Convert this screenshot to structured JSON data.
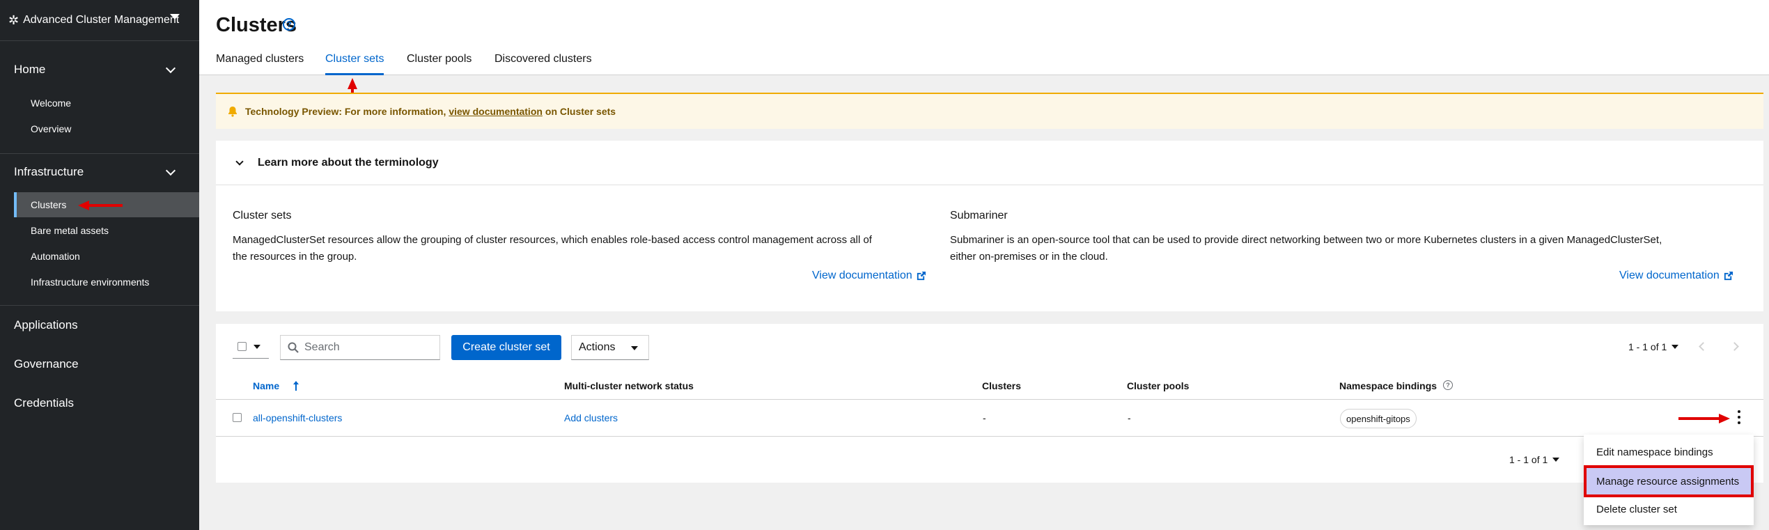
{
  "sidebar": {
    "brand": "Advanced Cluster Management",
    "groups": [
      {
        "label": "Home",
        "items": [
          "Welcome",
          "Overview"
        ]
      },
      {
        "label": "Infrastructure",
        "items": [
          "Clusters",
          "Bare metal assets",
          "Automation",
          "Infrastructure environments"
        ]
      },
      {
        "label": "Applications"
      },
      {
        "label": "Governance"
      },
      {
        "label": "Credentials"
      }
    ],
    "active_item": "Clusters"
  },
  "header": {
    "title": "Clusters",
    "tabs": [
      "Managed clusters",
      "Cluster sets",
      "Cluster pools",
      "Discovered clusters"
    ],
    "active_tab": "Cluster sets"
  },
  "alert": {
    "prefix": "Technology Preview: For more information,",
    "link": "view documentation",
    "suffix": "on Cluster sets"
  },
  "terminology": {
    "heading": "Learn more about the terminology",
    "cluster_sets": {
      "title": "Cluster sets",
      "line1": "ManagedClusterSet resources allow the grouping of cluster resources, which enables role-based access control management across all of",
      "line2": "the resources in the group.",
      "link": "View documentation"
    },
    "submariner": {
      "title": "Submariner",
      "line1": "Submariner is an open-source tool that can be used to provide direct networking between two or more Kubernetes clusters in a given ManagedClusterSet,",
      "line2": "either on-premises or in the cloud.",
      "link": "View documentation"
    }
  },
  "toolbar": {
    "search_placeholder": "Search",
    "create_button": "Create cluster set",
    "actions_button": "Actions",
    "pagination": "1 - 1 of 1"
  },
  "table": {
    "columns": [
      "Name",
      "Multi-cluster network status",
      "Clusters",
      "Cluster pools",
      "Namespace bindings"
    ],
    "rows": [
      {
        "name": "all-openshift-clusters",
        "network_status": "Add clusters",
        "clusters": "-",
        "cluster_pools": "-",
        "namespace_bindings": "openshift-gitops"
      }
    ],
    "bottom_pagination": "1 - 1 of 1"
  },
  "row_menu": {
    "items": [
      "Edit namespace bindings",
      "Manage resource assignments",
      "Delete cluster set"
    ],
    "highlighted": "Manage resource assignments"
  },
  "colors": {
    "sidebar_bg": "#212427",
    "accent": "#0066cc",
    "alert_bg": "#fdf7e7",
    "annotation_red": "#e00000"
  }
}
